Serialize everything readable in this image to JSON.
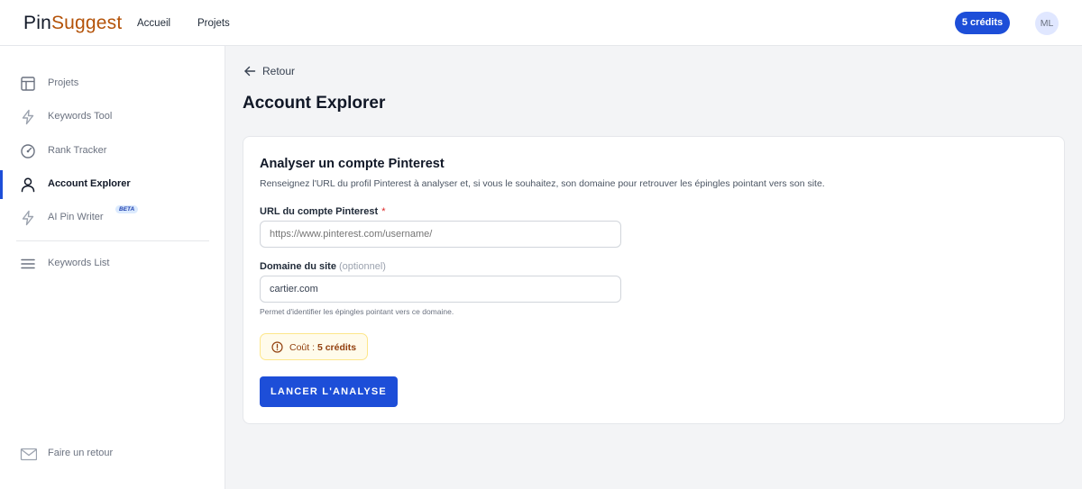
{
  "app": {
    "logo_part1": "Pin",
    "logo_part2": "Suggest"
  },
  "topnav": {
    "home": "Accueil",
    "projects": "Projets"
  },
  "account": {
    "credits": "5 crédits",
    "initials": "ML"
  },
  "sidebar": {
    "items": [
      {
        "label": "Projets",
        "icon": "layout-icon"
      },
      {
        "label": "Keywords Tool",
        "icon": "lightning-icon"
      },
      {
        "label": "Rank Tracker",
        "icon": "gauge-icon"
      },
      {
        "label": "Account Explorer",
        "icon": "user-icon",
        "active": true
      },
      {
        "label": "AI Pin Writer",
        "icon": "lightning-icon",
        "badge": "BETA"
      },
      {
        "label": "Keywords List",
        "icon": "menu-icon"
      }
    ],
    "feedback": {
      "label": "Faire un retour",
      "icon": "mail-icon"
    }
  },
  "main": {
    "back_label": "Retour",
    "title": "Account Explorer",
    "card": {
      "title": "Analyser un compte Pinterest",
      "description": "Renseignez l'URL du profil Pinterest à analyser et, si vous le souhaitez, son domaine pour retrouver les épingles pointant vers son site.",
      "url_field": {
        "label": "URL du compte Pinterest",
        "required_mark": "*",
        "placeholder": "https://www.pinterest.com/username/",
        "value": ""
      },
      "domain_field": {
        "label": "Domaine du site",
        "optional_note": "(optionnel)",
        "placeholder": "",
        "value": "cartier.com",
        "hint": "Permet d'identifier les épingles pointant vers ce domaine."
      },
      "cost": {
        "prefix": "Coût : ",
        "value": "5 crédits"
      },
      "submit_label": "LANCER L'ANALYSE"
    }
  },
  "colors": {
    "accent": "#1d4ed8",
    "logo_accent": "#b45309",
    "warning_bg": "#fffbeb",
    "warning_text": "#92400e"
  }
}
